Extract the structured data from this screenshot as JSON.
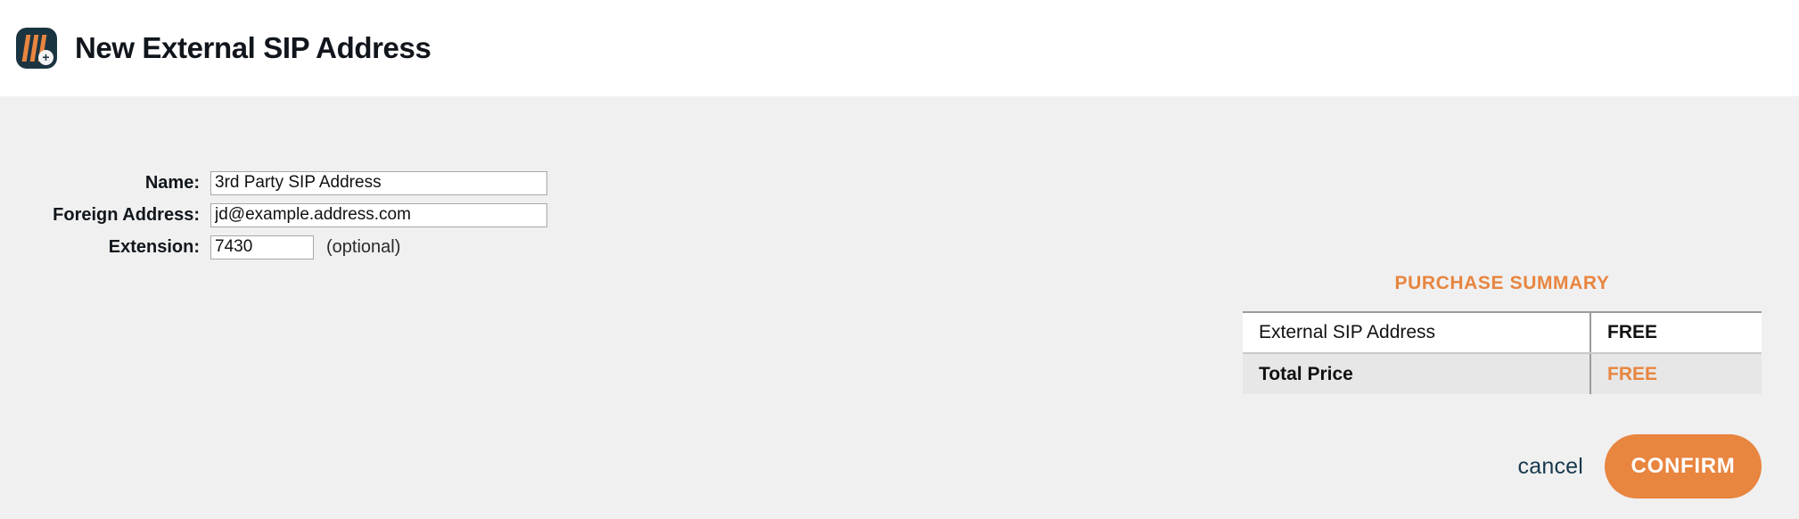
{
  "header": {
    "title": "New External SIP Address",
    "icon": "sip-app-icon",
    "badge_icon": "plus-badge-icon"
  },
  "form": {
    "fields": [
      {
        "label": "Name:",
        "value": "3rd Party SIP Address",
        "placeholder": "",
        "name": "name"
      },
      {
        "label": "Foreign Address:",
        "value": "jd@example.address.com",
        "placeholder": "",
        "name": "foreign-address"
      },
      {
        "label": "Extension:",
        "value": "7430",
        "placeholder": "",
        "name": "extension",
        "note": "(optional)"
      }
    ]
  },
  "purchase_summary": {
    "title": "PURCHASE SUMMARY",
    "rows": [
      {
        "item": "External SIP Address",
        "price": "FREE"
      }
    ],
    "total": {
      "item": "Total Price",
      "price": "FREE"
    }
  },
  "actions": {
    "cancel_label": "cancel",
    "confirm_label": "CONFIRM"
  },
  "colors": {
    "accent_orange": "#e8853f",
    "header_bg": "#ffffff",
    "body_bg": "#f0f0f0",
    "icon_navy": "#1b3442",
    "cancel_text": "#17394e",
    "total_row_bg": "#e7e7e7"
  }
}
